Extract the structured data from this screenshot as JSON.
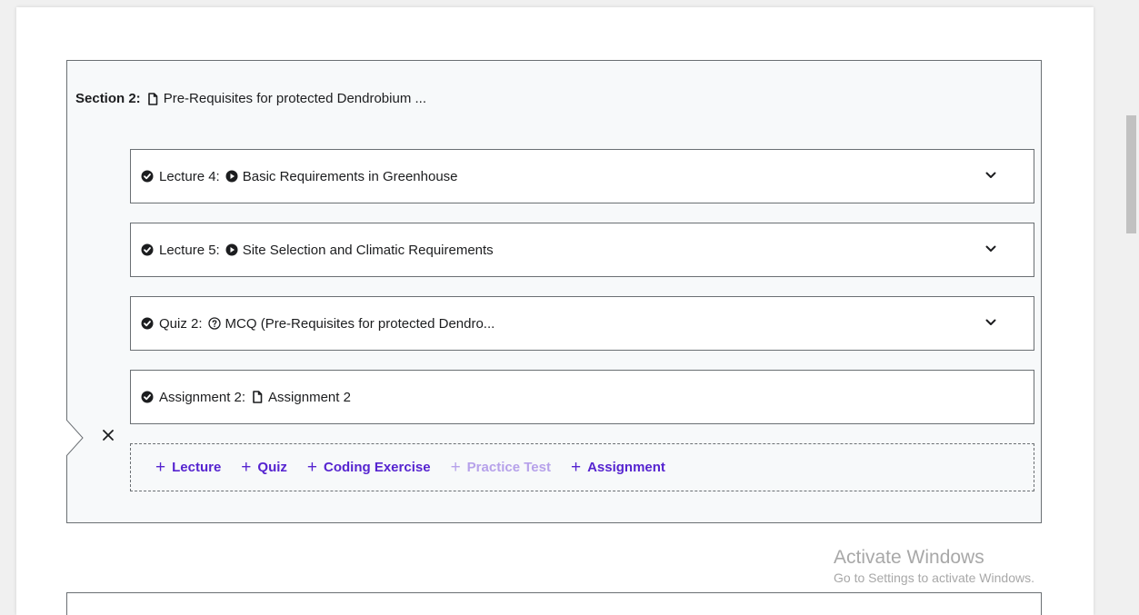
{
  "section": {
    "label": "Section 2:",
    "title": "Pre-Requisites for protected Dendrobium ...",
    "icon": "file-icon"
  },
  "items": [
    {
      "label": "Lecture 4:",
      "title": "Basic Requirements in Greenhouse",
      "type_icon": "play-circle-icon",
      "expandable": true
    },
    {
      "label": "Lecture 5:",
      "title": "Site Selection and Climatic Requirements",
      "type_icon": "play-circle-icon",
      "expandable": true
    },
    {
      "label": "Quiz 2:",
      "title": "MCQ (Pre-Requisites for protected Dendro...",
      "type_icon": "question-circle-icon",
      "expandable": true
    },
    {
      "label": "Assignment 2:",
      "title": "Assignment 2",
      "type_icon": "file-icon",
      "expandable": false
    }
  ],
  "add_bar": {
    "buttons": [
      {
        "label": "Lecture",
        "enabled": true
      },
      {
        "label": "Quiz",
        "enabled": true
      },
      {
        "label": "Coding Exercise",
        "enabled": true
      },
      {
        "label": "Practice Test",
        "enabled": false
      },
      {
        "label": "Assignment",
        "enabled": true
      }
    ],
    "plus_symbol": "+"
  },
  "watermark": {
    "line1": "Activate Windows",
    "line2": "Go to Settings to activate Windows."
  },
  "colors": {
    "accent": "#5624d0",
    "accent_disabled": "#b6a1ea",
    "border": "#6a6f73",
    "section_bg": "#f7f9fa"
  }
}
